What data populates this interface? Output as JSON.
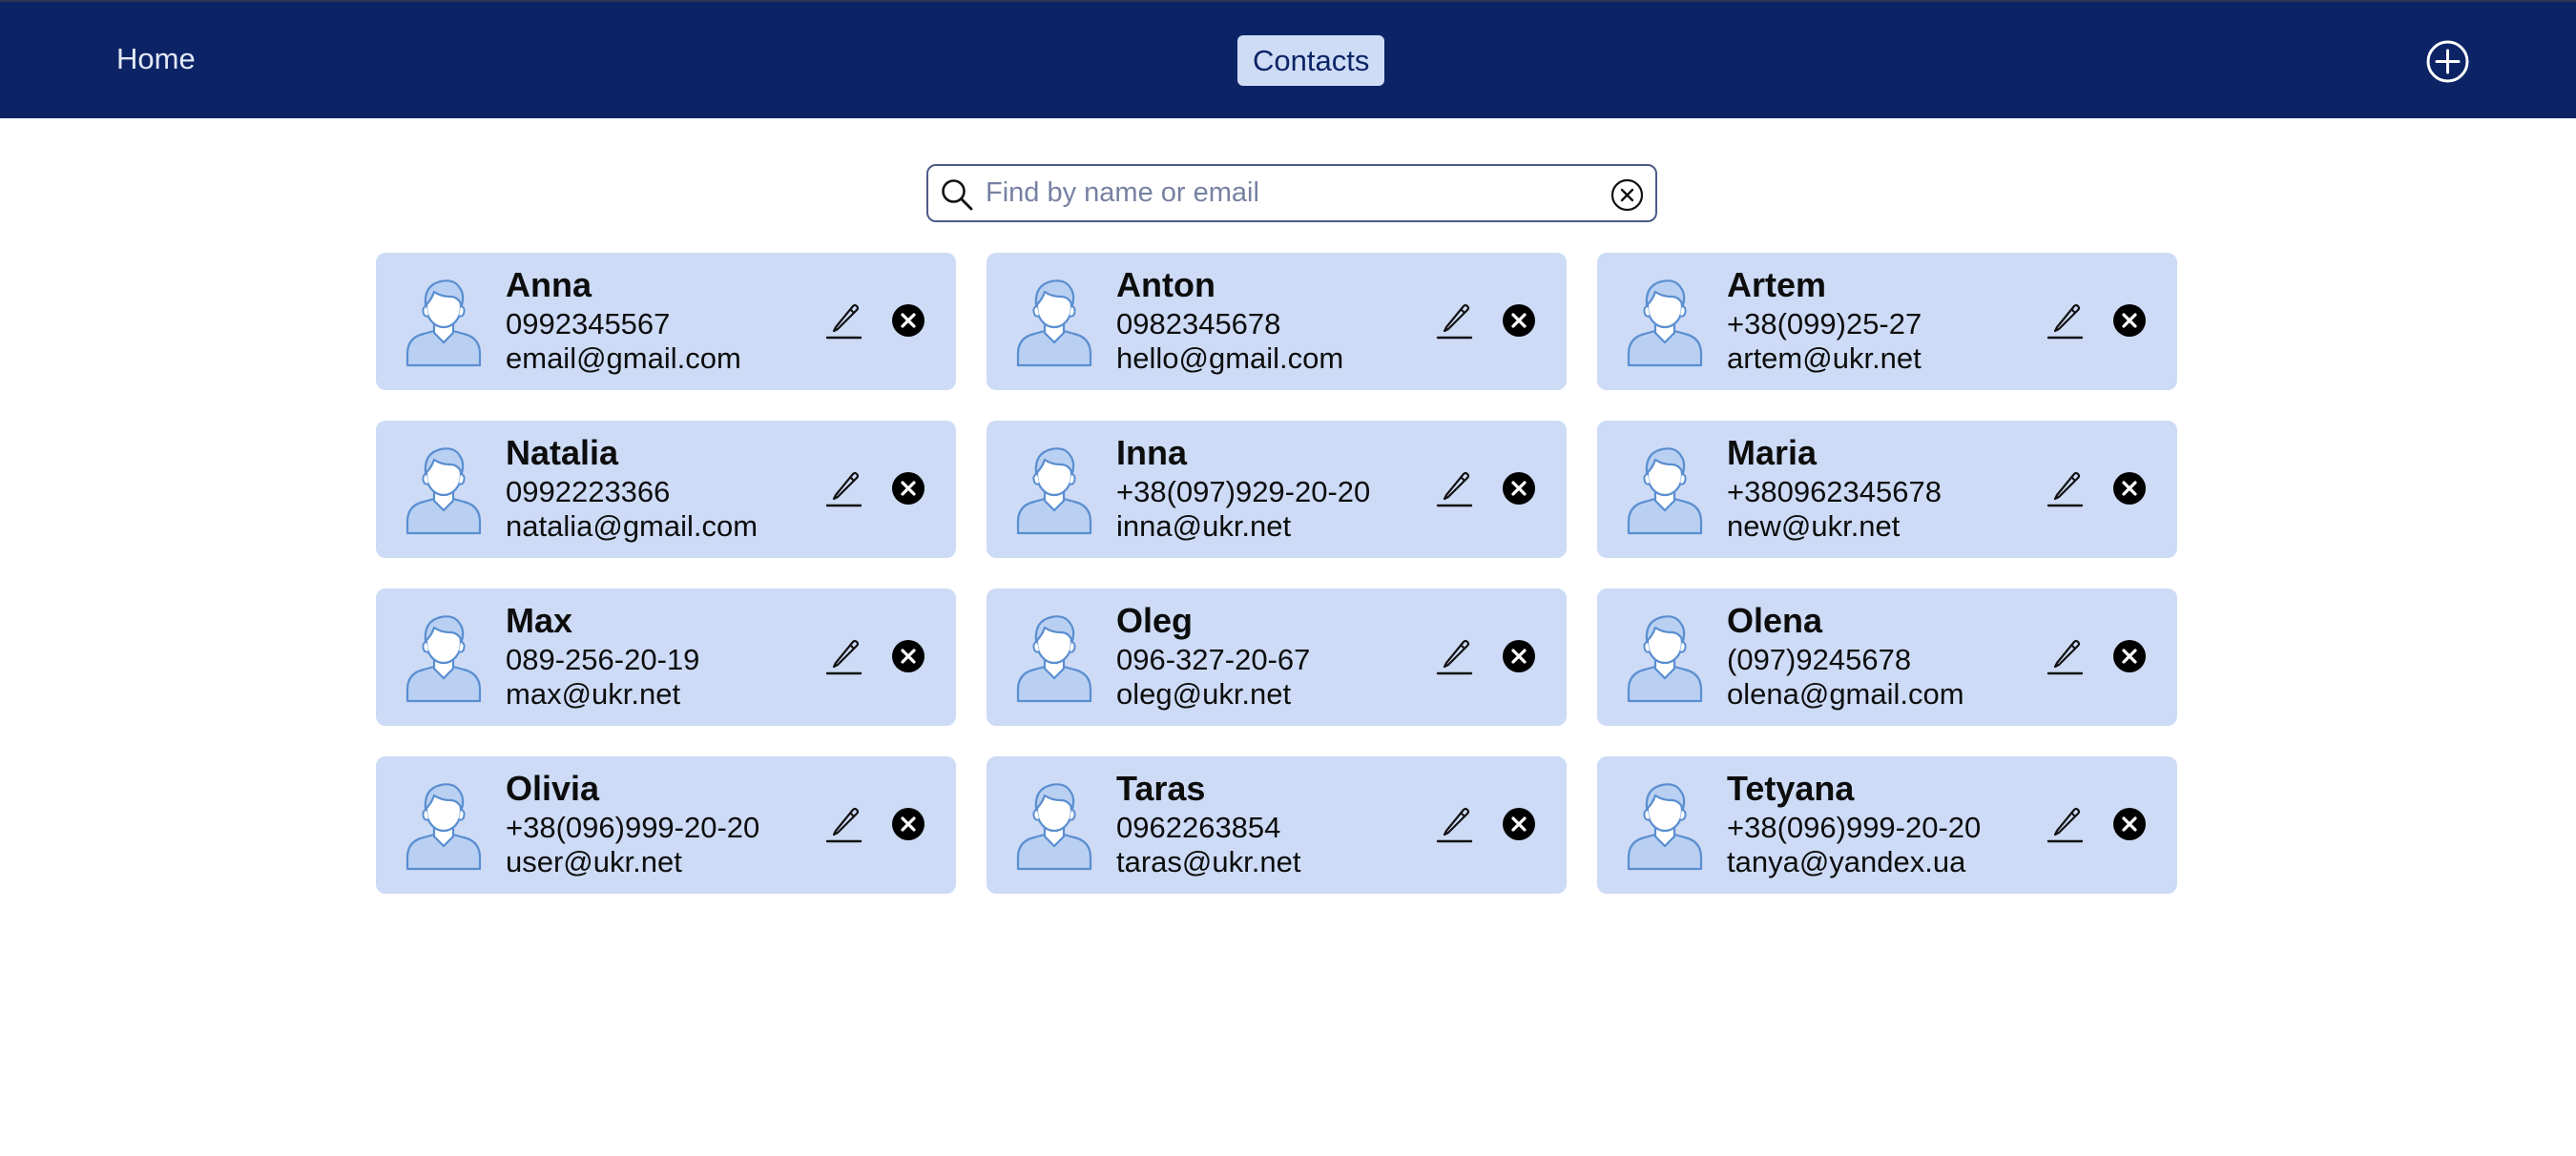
{
  "nav": {
    "home_label": "Home",
    "contacts_label": "Contacts",
    "add_icon": "plus-circle-icon"
  },
  "search": {
    "placeholder": "Find by name or email",
    "value": ""
  },
  "colors": {
    "header": "#0c2466",
    "card": "#cddbf6",
    "active_tab": "#cfdcf6",
    "avatar_stroke": "#5a8ed0"
  },
  "contacts": [
    {
      "name": "Anna",
      "phone": "0992345567",
      "email": "email@gmail.com"
    },
    {
      "name": "Anton",
      "phone": "0982345678",
      "email": "hello@gmail.com"
    },
    {
      "name": "Artem",
      "phone": "+38(099)25-27",
      "email": "artem@ukr.net"
    },
    {
      "name": "Natalia",
      "phone": "0992223366",
      "email": "natalia@gmail.com"
    },
    {
      "name": "Inna",
      "phone": "+38(097)929-20-20",
      "email": "inna@ukr.net"
    },
    {
      "name": "Maria",
      "phone": "+380962345678",
      "email": "new@ukr.net"
    },
    {
      "name": "Max",
      "phone": "089-256-20-19",
      "email": "max@ukr.net"
    },
    {
      "name": "Oleg",
      "phone": "096-327-20-67",
      "email": "oleg@ukr.net"
    },
    {
      "name": "Olena",
      "phone": "(097)9245678",
      "email": "olena@gmail.com"
    },
    {
      "name": "Olivia",
      "phone": "+38(096)999-20-20",
      "email": "user@ukr.net"
    },
    {
      "name": "Taras",
      "phone": "0962263854",
      "email": "taras@ukr.net"
    },
    {
      "name": "Tetyana",
      "phone": "+38(096)999-20-20",
      "email": "tanya@yandex.ua"
    }
  ]
}
